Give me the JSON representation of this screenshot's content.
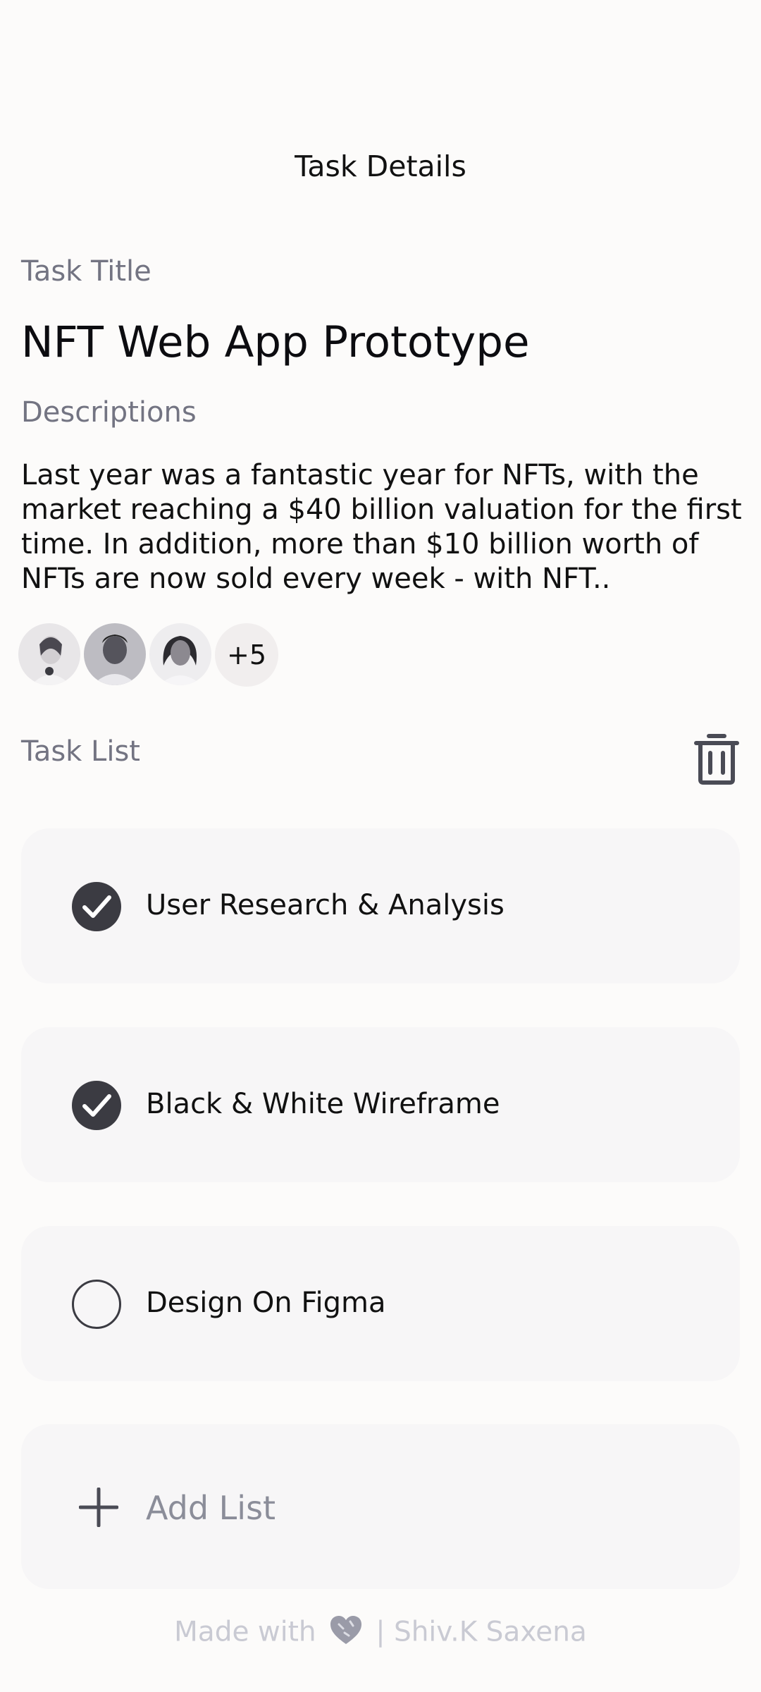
{
  "header": {
    "title": "Task Details"
  },
  "task": {
    "title_label": "Task Title",
    "title": "NFT Web App Prototype",
    "description_label": "Descriptions",
    "description": "Last year was a fantastic year for NFTs, with the market reaching a $40 billion valuation for the first time. In addition, more than $10 billion worth of NFTs are now sold every week - with NFT.."
  },
  "members": {
    "avatars": [
      "avatar-1",
      "avatar-2",
      "avatar-3"
    ],
    "more_count": "+5"
  },
  "task_list": {
    "label": "Task List",
    "delete_icon": "trash-icon",
    "items": [
      {
        "label": "User Research & Analysis",
        "done": true
      },
      {
        "label": "Black & White Wireframe",
        "done": true
      },
      {
        "label": "Design On Figma",
        "done": false
      }
    ],
    "add_label": "Add List"
  },
  "footer": {
    "made_with": "Made with",
    "author": "| Shiv.K Saxena"
  },
  "colors": {
    "background": "#fcfbfa",
    "card": "#f7f6f7",
    "check": "#3b3b42",
    "muted": "#737482"
  }
}
